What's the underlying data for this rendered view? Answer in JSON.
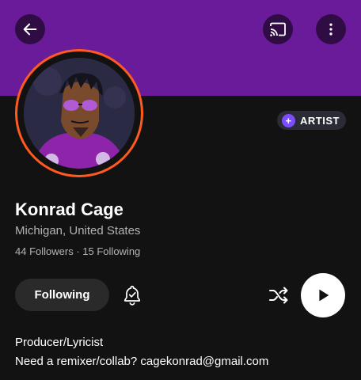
{
  "header": {
    "back_icon": "arrow-left-icon",
    "cast_icon": "cast-icon",
    "more_icon": "more-vertical-icon",
    "banner_color": "#6a1b9a"
  },
  "profile": {
    "name": "Konrad Cage",
    "location": "Michigan, United States",
    "followers": "44 Followers",
    "separator": "·",
    "following": "15 Following",
    "badge_label": "ARTIST",
    "badge_symbol": "+",
    "ring_color": "#ff5a1f"
  },
  "actions": {
    "follow_label": "Following",
    "bell_icon": "bell-check-icon",
    "shuffle_icon": "shuffle-icon",
    "play_icon": "play-icon"
  },
  "bio": {
    "line1": "Producer/Lyricist",
    "line2": "Need a remixer/collab? cagekonrad@gmail.com"
  }
}
